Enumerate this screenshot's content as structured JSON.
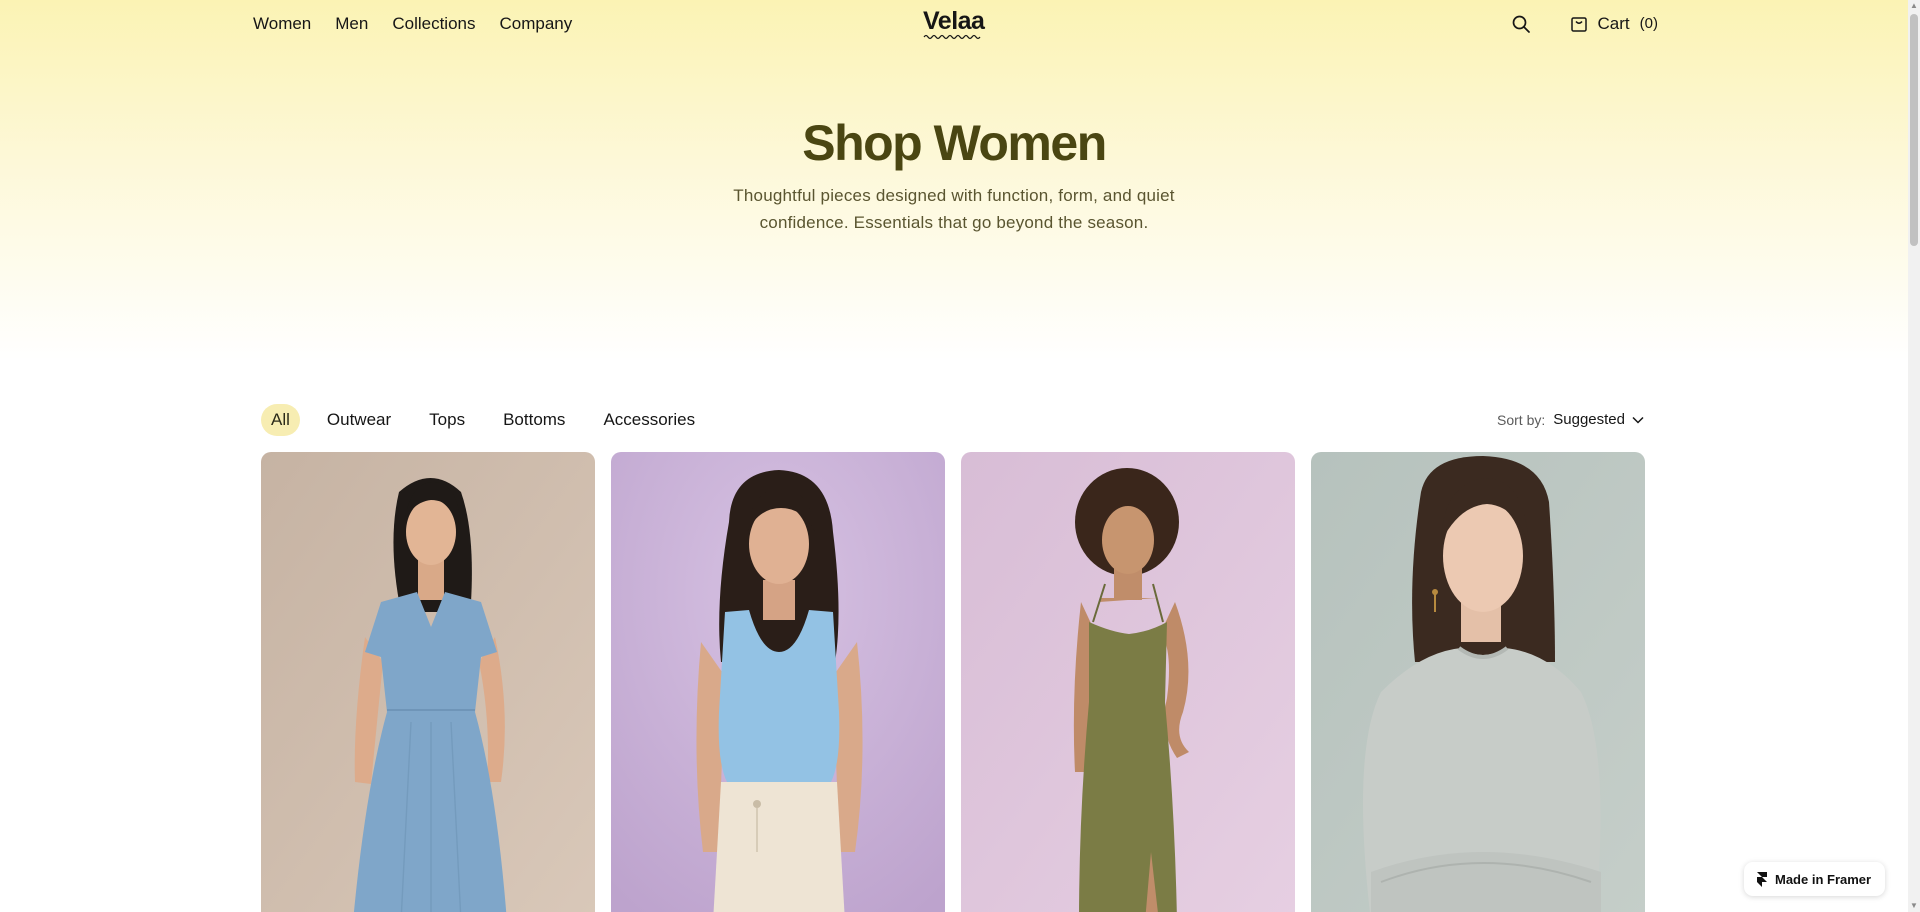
{
  "header": {
    "nav": [
      "Women",
      "Men",
      "Collections",
      "Company"
    ],
    "logo": "Velaa",
    "cart_label": "Cart",
    "cart_count": "(0)"
  },
  "hero": {
    "title": "Shop Women",
    "subtitle_line1": "Thoughtful pieces designed with function, form, and quiet",
    "subtitle_line2": "confidence. Essentials that go beyond the season."
  },
  "filters": {
    "items": [
      "All",
      "Outwear",
      "Tops",
      "Bottoms",
      "Accessories"
    ],
    "active": "All"
  },
  "sort": {
    "label": "Sort by:",
    "value": "Suggested"
  },
  "products": [
    {
      "image": "woman-in-blue-dress",
      "bg": "#c9b6a6"
    },
    {
      "image": "woman-in-blue-tank-top",
      "bg": "#c8b0d5"
    },
    {
      "image": "woman-in-olive-slip-dress",
      "bg": "#dcc3dc"
    },
    {
      "image": "woman-in-grey-sweater",
      "bg": "#b9c3be"
    }
  ],
  "badge": {
    "label": "Made in Framer"
  },
  "colors": {
    "hero_gradient_top": "#fbf3b4",
    "title": "#4a4612",
    "active_chip": "#f7edb2"
  }
}
